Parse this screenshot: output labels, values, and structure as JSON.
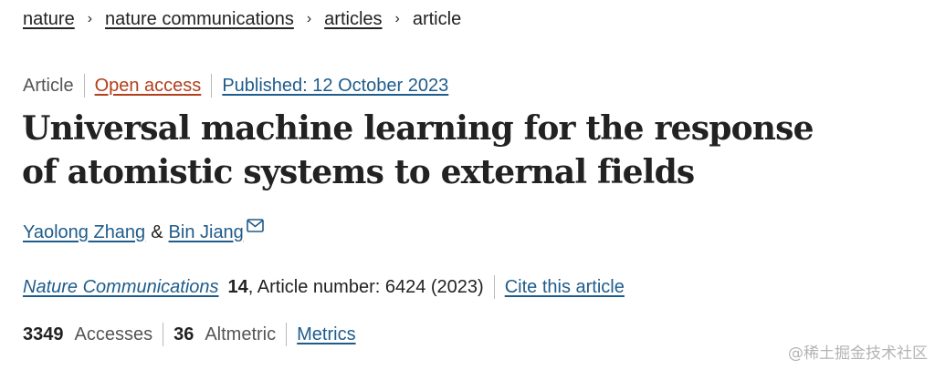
{
  "breadcrumb": {
    "items": [
      "nature",
      "nature communications",
      "articles"
    ],
    "current": "article",
    "separator": "›"
  },
  "meta": {
    "type": "Article",
    "access": "Open access",
    "published": "Published: 12 October 2023"
  },
  "title": "Universal machine learning for the response of atomistic systems to external fields",
  "authors": {
    "first": "Yaolong Zhang",
    "separator": "&",
    "second": "Bin Jiang",
    "mail_icon": "envelope-icon"
  },
  "citation": {
    "journal": "Nature Communications",
    "volume": "14",
    "article_number": ", Article number: 6424 (2023)",
    "cite_label": "Cite this article"
  },
  "metrics": {
    "accesses_count": "3349",
    "accesses_label": "Accesses",
    "altmetric_count": "36",
    "altmetric_label": "Altmetric",
    "metrics_link": "Metrics"
  },
  "watermark": "@稀土掘金技术社区",
  "colors": {
    "link_blue": "#1f5c8b",
    "open_access": "#b1401c",
    "text": "#222222",
    "muted": "#555555"
  }
}
